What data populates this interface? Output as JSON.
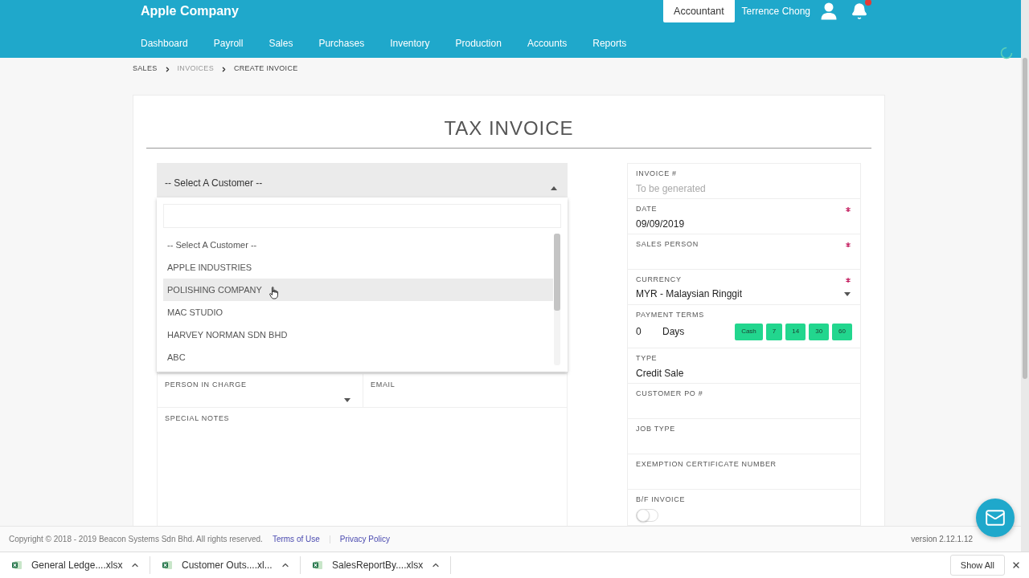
{
  "header": {
    "company": "Apple Company",
    "role_button": "Accountant",
    "user_name": "Terrence Chong",
    "has_notification": true
  },
  "nav": [
    {
      "label": "Dashboard"
    },
    {
      "label": "Payroll"
    },
    {
      "label": "Sales"
    },
    {
      "label": "Purchases"
    },
    {
      "label": "Inventory"
    },
    {
      "label": "Production"
    },
    {
      "label": "Accounts"
    },
    {
      "label": "Reports"
    }
  ],
  "breadcrumb": [
    {
      "label": "SALES",
      "muted": false
    },
    {
      "label": "INVOICES",
      "muted": true
    },
    {
      "label": "CREATE INVOICE",
      "muted": false
    }
  ],
  "title": "TAX INVOICE",
  "customer": {
    "value": "-- Select A Customer --",
    "expanded": true,
    "options": [
      {
        "label": "-- Select A Customer --",
        "highlighted": false
      },
      {
        "label": "APPLE INDUSTRIES",
        "highlighted": false
      },
      {
        "label": "POLISHING COMPANY",
        "highlighted": true
      },
      {
        "label": "MAC STUDIO",
        "highlighted": false
      },
      {
        "label": "HARVEY NORMAN SDN BHD",
        "highlighted": false
      },
      {
        "label": "ABC",
        "highlighted": false
      }
    ]
  },
  "contact": {
    "person_in_charge": {
      "label": "PERSON IN CHARGE"
    },
    "email": {
      "label": "EMAIL"
    }
  },
  "special_notes": {
    "label": "SPECIAL NOTES"
  },
  "details": [
    {
      "kind": "text",
      "label": "INVOICE #",
      "placeholder": "To be generated",
      "required": false
    },
    {
      "kind": "text",
      "label": "DATE",
      "value": "09/09/2019",
      "required": true
    },
    {
      "kind": "text",
      "label": "SALES PERSON",
      "required": true
    },
    {
      "kind": "select",
      "label": "CURRENCY",
      "value": "MYR - Malaysian Ringgit",
      "required": true
    },
    {
      "kind": "terms",
      "label": "PAYMENT TERMS",
      "value": "0",
      "unit": "Days",
      "presets": [
        "Cash",
        "7",
        "14",
        "30",
        "60"
      ],
      "required": false
    },
    {
      "kind": "text",
      "label": "TYPE",
      "value": "Credit Sale",
      "required": false
    },
    {
      "kind": "text",
      "label": "CUSTOMER PO #",
      "required": false
    },
    {
      "kind": "text",
      "label": "JOB TYPE",
      "required": false
    },
    {
      "kind": "text",
      "label": "EXEMPTION CERTIFICATE NUMBER",
      "required": false
    },
    {
      "kind": "toggle",
      "label": "B/F INVOICE",
      "on": false,
      "required": false
    }
  ],
  "footer": {
    "copyright": "Copyright © 2018 - 2019 Beacon Systems Sdn Bhd. All rights reserved.",
    "links": [
      "Terms of Use",
      "Privacy Policy"
    ],
    "version": "version 2.12.1.12"
  },
  "downloads": {
    "items": [
      {
        "name": "General Ledge....xlsx"
      },
      {
        "name": "Customer Outs....xl..."
      },
      {
        "name": "SalesReportBy....xlsx"
      }
    ],
    "show_all": "Show All"
  }
}
